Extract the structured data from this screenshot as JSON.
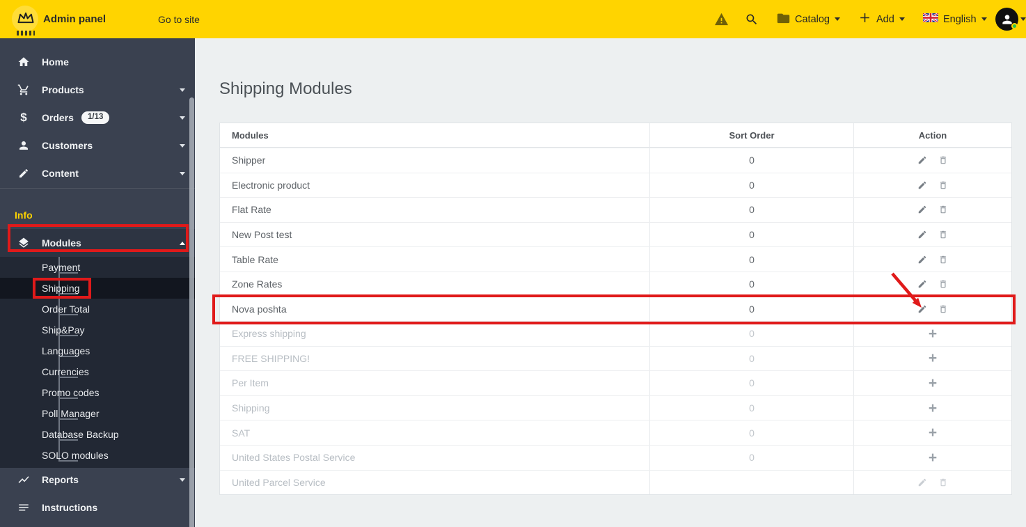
{
  "topbar": {
    "brand": "Admin panel",
    "go_to_site": "Go to site",
    "catalog": "Catalog",
    "add": "Add",
    "language": "English"
  },
  "sidebar": {
    "items": [
      {
        "label": "Home"
      },
      {
        "label": "Products"
      },
      {
        "label": "Orders",
        "badge": "1/13"
      },
      {
        "label": "Customers"
      },
      {
        "label": "Content"
      }
    ],
    "section": "Info",
    "modules_label": "Modules",
    "submenu": [
      "Payment",
      "Shipping",
      "Order Total",
      "Ship&Pay",
      "Languages",
      "Currencies",
      "Promo codes",
      "Poll Manager",
      "Database Backup",
      "SOLO modules"
    ],
    "active_submenu": "Shipping",
    "reports_label": "Reports",
    "instructions_label": "Instructions"
  },
  "main": {
    "title": "Shipping Modules",
    "table": {
      "headers": [
        "Modules",
        "Sort Order",
        "Action"
      ],
      "rows": [
        {
          "name": "Shipper",
          "sort": "0",
          "state": "installed",
          "actions": [
            "edit",
            "delete"
          ]
        },
        {
          "name": "Electronic product",
          "sort": "0",
          "state": "installed",
          "actions": [
            "edit",
            "delete"
          ]
        },
        {
          "name": "Flat Rate",
          "sort": "0",
          "state": "installed",
          "actions": [
            "edit",
            "delete"
          ]
        },
        {
          "name": "New Post test",
          "sort": "0",
          "state": "installed",
          "actions": [
            "edit",
            "delete"
          ]
        },
        {
          "name": "Table Rate",
          "sort": "0",
          "state": "installed",
          "actions": [
            "edit",
            "delete"
          ]
        },
        {
          "name": "Zone Rates",
          "sort": "0",
          "state": "installed",
          "actions": [
            "edit",
            "delete"
          ]
        },
        {
          "name": "Nova poshta",
          "sort": "0",
          "state": "installed",
          "actions": [
            "edit",
            "delete"
          ],
          "highlighted": true
        },
        {
          "name": "Express shipping",
          "sort": "0",
          "state": "not_installed",
          "actions": [
            "install"
          ]
        },
        {
          "name": "FREE SHIPPING!",
          "sort": "0",
          "state": "not_installed",
          "actions": [
            "install"
          ]
        },
        {
          "name": "Per Item",
          "sort": "0",
          "state": "not_installed",
          "actions": [
            "install"
          ]
        },
        {
          "name": "Shipping",
          "sort": "0",
          "state": "not_installed",
          "actions": [
            "install"
          ]
        },
        {
          "name": "SAT",
          "sort": "0",
          "state": "not_installed",
          "actions": [
            "install"
          ]
        },
        {
          "name": "United States Postal Service",
          "sort": "0",
          "state": "not_installed",
          "actions": [
            "install"
          ]
        },
        {
          "name": "United Parcel Service",
          "sort": "",
          "state": "disabled",
          "actions": [
            "edit",
            "delete"
          ]
        }
      ]
    }
  },
  "colors": {
    "topbar": "#ffd400",
    "sidebar": "#3a4150",
    "submenu_bg": "#222834",
    "active_item_bg": "#12161f",
    "accent_yellow": "#ffd400",
    "main_bg": "#edf0f1",
    "annotation_red": "#e01a1a"
  }
}
